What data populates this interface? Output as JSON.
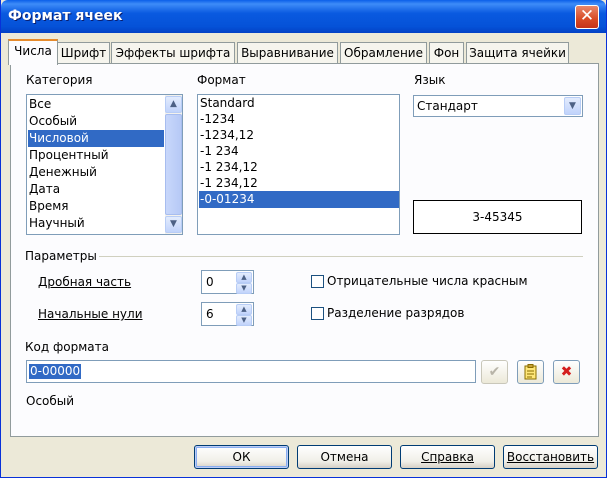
{
  "window": {
    "title": "Формат ячеек",
    "close_symbol": "✕"
  },
  "tabs": [
    "Числа",
    "Шрифт",
    "Эффекты шрифта",
    "Выравнивание",
    "Обрамление",
    "Фон",
    "Защита ячейки"
  ],
  "category": {
    "label": "Категория",
    "items": [
      "Все",
      "Особый",
      "Числовой",
      "Процентный",
      "Денежный",
      "Дата",
      "Время",
      "Научный"
    ],
    "selected_index": 2
  },
  "format": {
    "label": "Формат",
    "items": [
      "Standard",
      "-1234",
      "-1234,12",
      "-1 234",
      "-1 234,12",
      "-1 234,12",
      "-0-01234"
    ],
    "selected_index": 6
  },
  "language": {
    "label": "Язык",
    "value": "Стандарт"
  },
  "preview": {
    "value": "3-45345"
  },
  "parameters": {
    "label": "Параметры",
    "decimal_label": "Дробная часть",
    "decimal_value": "0",
    "leading_zeros_label": "Начальные нули",
    "leading_zeros_value": "6",
    "negative_red_label": "Отрицательные числа красным",
    "negative_red_checked": false,
    "thousands_sep_label": "Разделение разрядов",
    "thousands_sep_checked": false
  },
  "format_code": {
    "label": "Код формата",
    "value": "0-00000"
  },
  "format_type": "Особый",
  "buttons": {
    "ok": "ОК",
    "cancel": "Отмена",
    "help": "Справка",
    "reset": "Восстановить"
  },
  "icons": [
    "checkmark-icon",
    "edit-comment-icon",
    "delete-icon"
  ]
}
